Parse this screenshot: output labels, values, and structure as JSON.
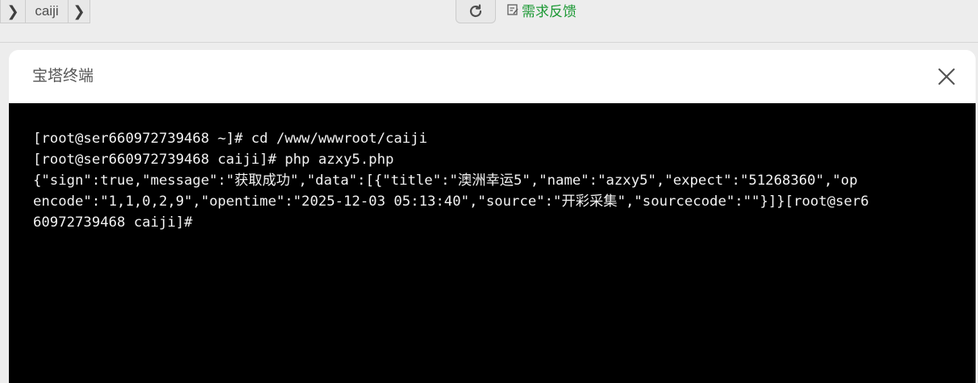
{
  "toolbar": {
    "path_segment": "caiji",
    "feedback_label": "需求反馈"
  },
  "modal": {
    "title": "宝塔终端"
  },
  "terminal": {
    "lines": [
      "[root@ser660972739468 ~]# cd /www/wwwroot/caiji",
      "[root@ser660972739468 caiji]# php azxy5.php",
      "{\"sign\":true,\"message\":\"获取成功\",\"data\":[{\"title\":\"澳洲幸运5\",\"name\":\"azxy5\",\"expect\":\"51268360\",\"op",
      "encode\":\"1,1,0,2,9\",\"opentime\":\"2025-12-03 05:13:40\",\"source\":\"开彩采集\",\"sourcecode\":\"\"}]}[root@ser6",
      "60972739468 caiji]#"
    ]
  },
  "colors": {
    "accent_green": "#20a53a",
    "terminal_bg": "#000000",
    "terminal_fg": "#f2f2f2"
  }
}
